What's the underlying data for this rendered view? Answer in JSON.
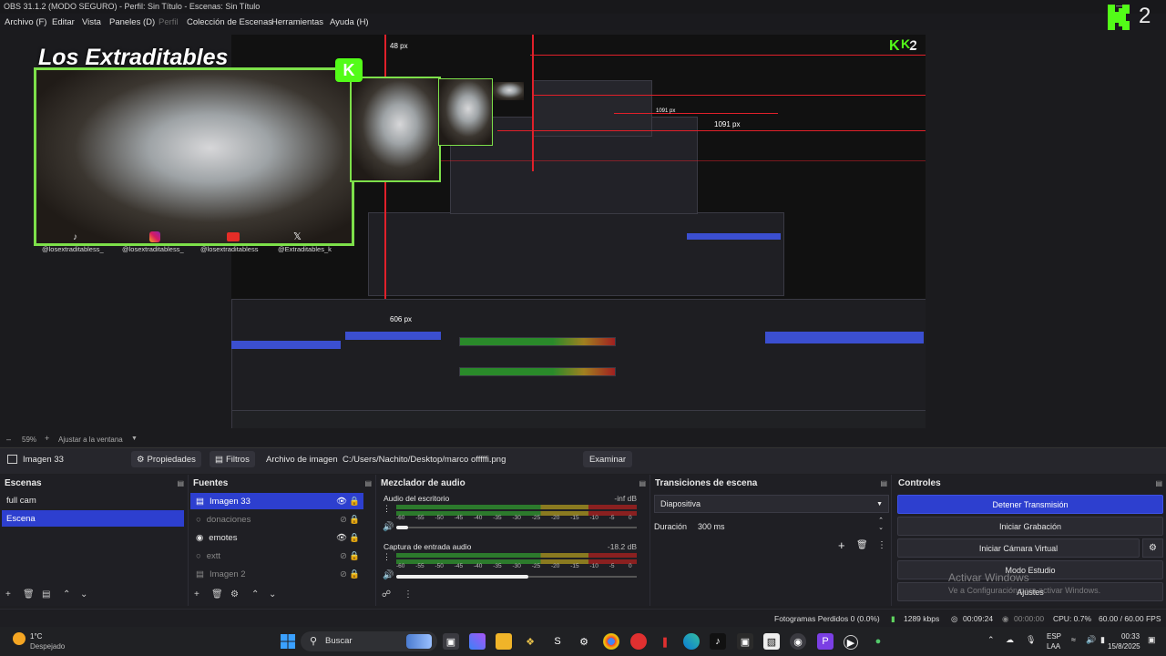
{
  "window": {
    "title": "OBS 31.1.2 (MODO SEGURO) - Perfil: Sin Título - Escenas: Sin Título",
    "menu": [
      "Archivo (F)",
      "Editar",
      "Vista",
      "Paneles (D)",
      "Perfil",
      "Colección de Escenas",
      "Herramientas",
      "Ayuda (H)"
    ],
    "k_badge": "2"
  },
  "preview": {
    "overlay_title": "Los Extraditables",
    "socials": [
      "@losextraditabless_",
      "@losextraditabless_",
      "@losextraditabless",
      "@Extraditables_k"
    ],
    "measure_labels": [
      "48 px",
      "1091 px",
      "606 px",
      "1091 px"
    ],
    "nested_k_badge": "2",
    "zoom": "59%",
    "fit_label": "Ajustar a la ventana"
  },
  "source_toolbar": {
    "source_name": "Imagen 33",
    "properties": "Propiedades",
    "filters": "Filtros",
    "image_file_label": "Archivo de imagen",
    "image_path": "C:/Users/Nachito/Desktop/marco offfffi.png",
    "browse": "Examinar"
  },
  "scenes": {
    "title": "Escenas",
    "items": [
      {
        "label": "full cam",
        "selected": false
      },
      {
        "label": "Escena",
        "selected": true
      }
    ]
  },
  "sources": {
    "title": "Fuentes",
    "items": [
      {
        "label": "Imagen 33",
        "visible": true,
        "selected": true
      },
      {
        "label": "donaciones",
        "visible": false,
        "selected": false
      },
      {
        "label": "emotes",
        "visible": true,
        "selected": false
      },
      {
        "label": "extt",
        "visible": false,
        "selected": false
      },
      {
        "label": "Imagen 2",
        "visible": false,
        "selected": false
      }
    ]
  },
  "mixer": {
    "title": "Mezclador de audio",
    "channels": [
      {
        "name": "Audio del escritorio",
        "level": "-inf dB",
        "volume": 0.05
      },
      {
        "name": "Captura de entrada audio",
        "level": "-18.2 dB",
        "volume": 0.55
      }
    ],
    "ticks": [
      "-60",
      "-55",
      "-50",
      "-45",
      "-40",
      "-35",
      "-30",
      "-25",
      "-20",
      "-15",
      "-10",
      "-5",
      "0"
    ]
  },
  "transitions": {
    "title": "Transiciones de escena",
    "selected": "Diapositiva",
    "duration_label": "Duración",
    "duration_value": "300 ms"
  },
  "controls": {
    "title": "Controles",
    "buttons": [
      "Detener Transmisión",
      "Iniciar Grabación",
      "Iniciar Cámara Virtual",
      "Modo Estudio",
      "Ajustes"
    ]
  },
  "watermark": {
    "line1": "Activar Windows",
    "line2": "Ve a Configuración para activar Windows."
  },
  "status": {
    "dropped_frames": "Fotogramas Perdidos 0 (0.0%)",
    "bitrate": "1289 kbps",
    "stream_time": "00:09:24",
    "rec_time": "00:00:00",
    "cpu": "CPU: 0.7%",
    "fps": "60.00 / 60.00 FPS"
  },
  "taskbar": {
    "weather_temp": "1°C",
    "weather_desc": "Despejado",
    "search": "Buscar",
    "lang": "ESP",
    "region": "LAA",
    "time": "00:33",
    "date": "15/8/2025"
  },
  "colors": {
    "accent": "#2d3fcf",
    "frame_green": "#7de04a",
    "measure_red": "#e0202a"
  }
}
